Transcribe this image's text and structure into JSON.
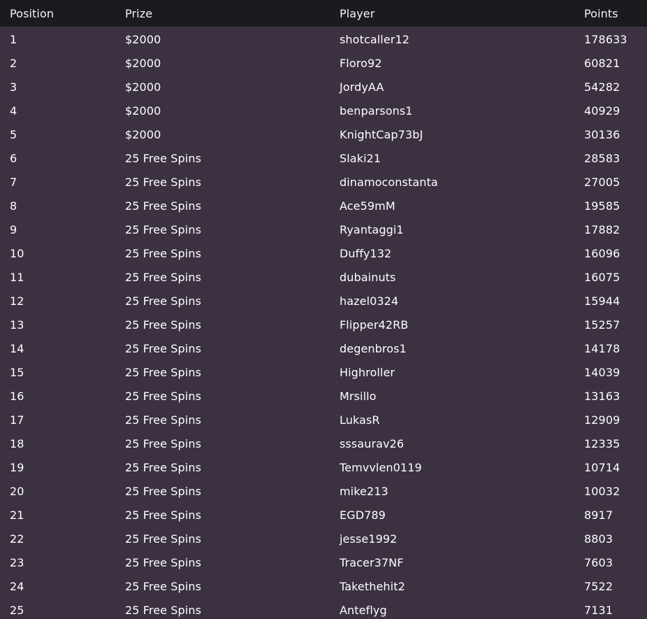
{
  "table": {
    "headers": {
      "position": "Position",
      "prize": "Prize",
      "player": "Player",
      "points": "Points"
    },
    "rows": [
      {
        "position": "1",
        "prize": "$2000",
        "player": "shotcaller12",
        "points": "178633"
      },
      {
        "position": "2",
        "prize": "$2000",
        "player": "Floro92",
        "points": "60821"
      },
      {
        "position": "3",
        "prize": "$2000",
        "player": "JordyAA",
        "points": "54282"
      },
      {
        "position": "4",
        "prize": "$2000",
        "player": "benparsons1",
        "points": "40929"
      },
      {
        "position": "5",
        "prize": "$2000",
        "player": "KnightCap73bJ",
        "points": "30136"
      },
      {
        "position": "6",
        "prize": "25 Free Spins",
        "player": "Slaki21",
        "points": "28583"
      },
      {
        "position": "7",
        "prize": "25 Free Spins",
        "player": "dinamoconstanta",
        "points": "27005"
      },
      {
        "position": "8",
        "prize": "25 Free Spins",
        "player": "Ace59mM",
        "points": "19585"
      },
      {
        "position": "9",
        "prize": "25 Free Spins",
        "player": "Ryantaggi1",
        "points": "17882"
      },
      {
        "position": "10",
        "prize": "25 Free Spins",
        "player": "Duffy132",
        "points": "16096"
      },
      {
        "position": "11",
        "prize": "25 Free Spins",
        "player": "dubainuts",
        "points": "16075"
      },
      {
        "position": "12",
        "prize": "25 Free Spins",
        "player": "hazel0324",
        "points": "15944"
      },
      {
        "position": "13",
        "prize": "25 Free Spins",
        "player": "Flipper42RB",
        "points": "15257"
      },
      {
        "position": "14",
        "prize": "25 Free Spins",
        "player": "degenbros1",
        "points": "14178"
      },
      {
        "position": "15",
        "prize": "25 Free Spins",
        "player": "Highroller",
        "points": "14039"
      },
      {
        "position": "16",
        "prize": "25 Free Spins",
        "player": "Mrsillo",
        "points": "13163"
      },
      {
        "position": "17",
        "prize": "25 Free Spins",
        "player": "LukasR",
        "points": "12909"
      },
      {
        "position": "18",
        "prize": "25 Free Spins",
        "player": "sssaurav26",
        "points": "12335"
      },
      {
        "position": "19",
        "prize": "25 Free Spins",
        "player": "Temvvlen0119",
        "points": "10714"
      },
      {
        "position": "20",
        "prize": "25 Free Spins",
        "player": "mike213",
        "points": "10032"
      },
      {
        "position": "21",
        "prize": "25 Free Spins",
        "player": "EGD789",
        "points": "8917"
      },
      {
        "position": "22",
        "prize": "25 Free Spins",
        "player": "jesse1992",
        "points": "8803"
      },
      {
        "position": "23",
        "prize": "25 Free Spins",
        "player": "Tracer37NF",
        "points": "7603"
      },
      {
        "position": "24",
        "prize": "25 Free Spins",
        "player": "Takethehit2",
        "points": "7522"
      },
      {
        "position": "25",
        "prize": "25 Free Spins",
        "player": "Anteflyg",
        "points": "7131"
      }
    ]
  },
  "colors": {
    "header_background": "#1b1a1f",
    "table_background": "#3b3140",
    "text": "#ffffff"
  }
}
